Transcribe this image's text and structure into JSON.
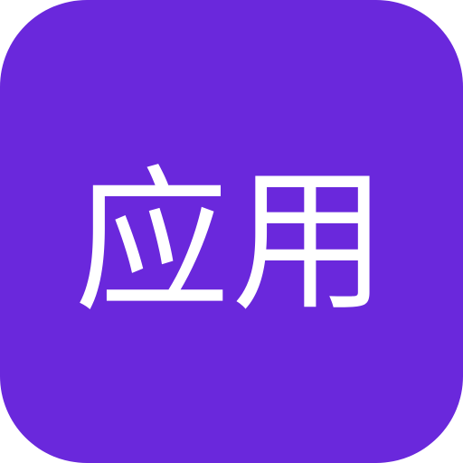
{
  "app_icon": {
    "label": "应用",
    "background_color": "#6a28dc",
    "text_color": "#ffffff"
  }
}
